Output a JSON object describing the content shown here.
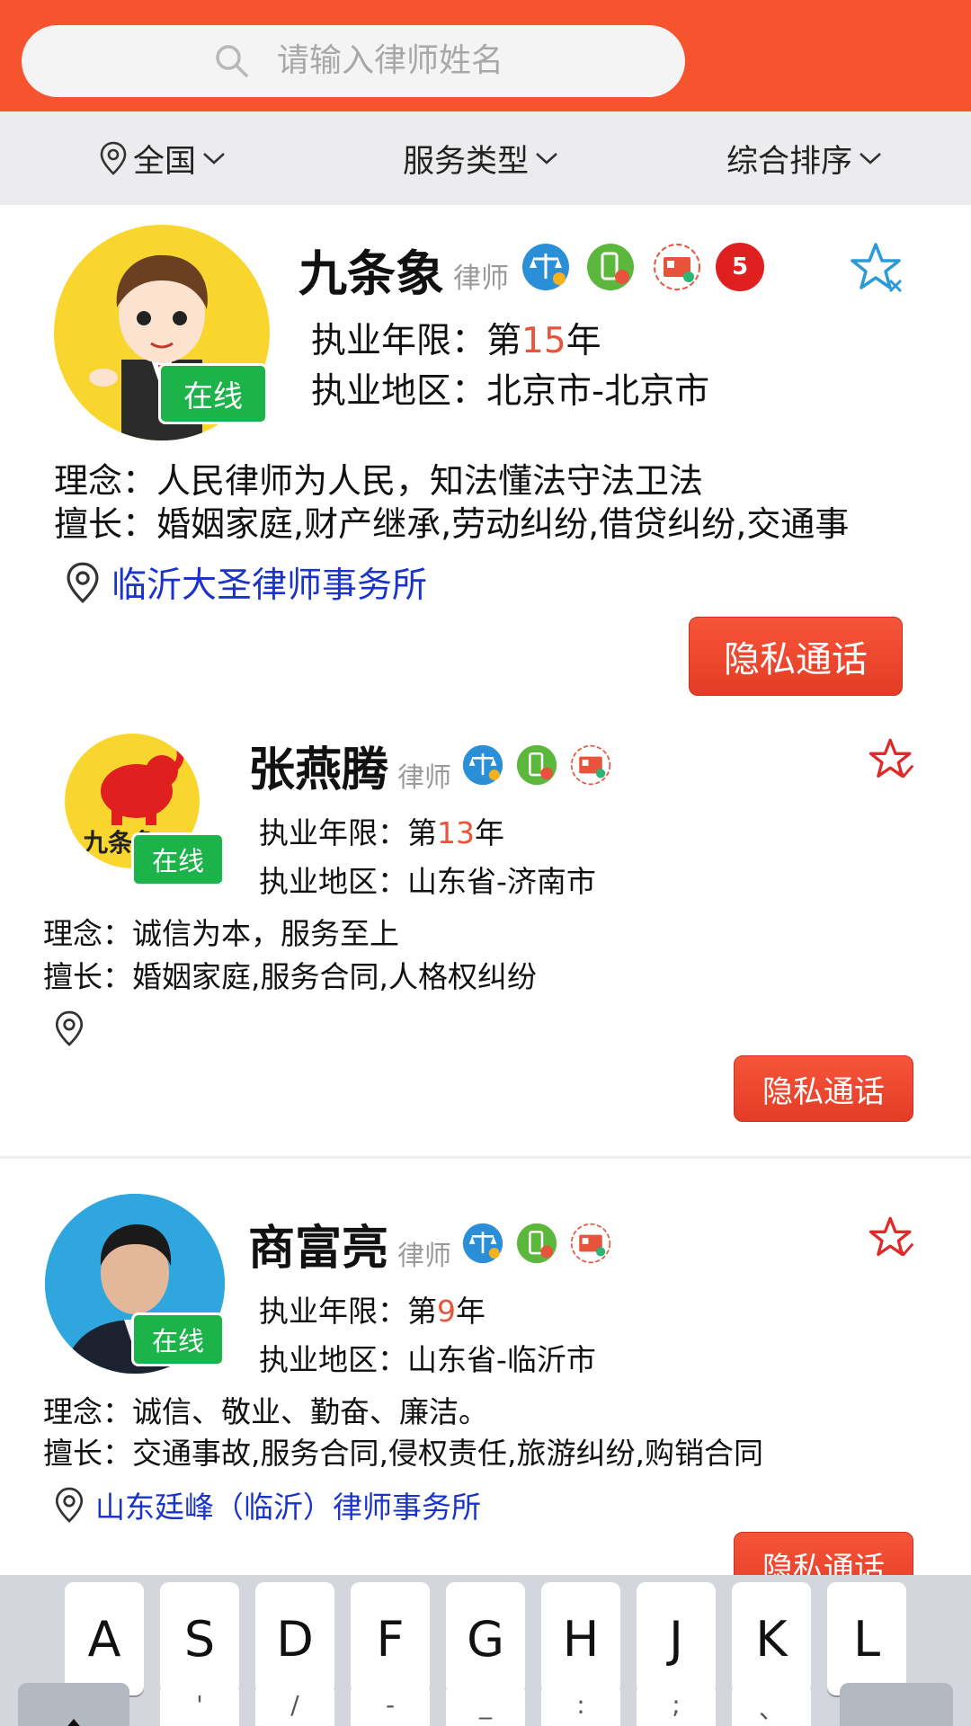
{
  "search": {
    "placeholder": "请输入律师姓名"
  },
  "filters": [
    {
      "label": "全国"
    },
    {
      "label": "服务类型"
    },
    {
      "label": "综合排序"
    }
  ],
  "lawyers": [
    {
      "name": "九条象",
      "role": "律师",
      "online": "在线",
      "years_prefix": "执业年限：第",
      "years": "15",
      "years_suffix": "年",
      "region_label": "执业地区：",
      "region": "北京市-北京市",
      "motto_label": "理念：",
      "motto": "人民律师为人民，知法懂法守法卫法",
      "expertise_label": "擅长：",
      "expertise": "婚姻家庭,财产继承,劳动纠纷,借贷纠纷,交通事",
      "firm": "临沂大圣律师事务所",
      "call": "隐私通话",
      "rank_badge": "5"
    },
    {
      "name": "张燕腾",
      "role": "律师",
      "online": "在线",
      "logo_text": "九条象",
      "years_prefix": "执业年限：第",
      "years": "13",
      "years_suffix": "年",
      "region_label": "执业地区：",
      "region": "山东省-济南市",
      "motto_label": "理念：",
      "motto": "诚信为本，服务至上",
      "expertise_label": "擅长：",
      "expertise": "婚姻家庭,服务合同,人格权纠纷",
      "firm": "",
      "call": "隐私通话"
    },
    {
      "name": "商富亮",
      "role": "律师",
      "online": "在线",
      "years_prefix": "执业年限：第",
      "years": "9",
      "years_suffix": "年",
      "region_label": "执业地区：",
      "region": "山东省-临沂市",
      "motto_label": "理念：",
      "motto": "诚信、敬业、勤奋、廉洁。",
      "expertise_label": "擅长：",
      "expertise": "交通事故,服务合同,侵权责任,旅游纠纷,购销合同",
      "firm": "山东廷峰（临沂）律师事务所",
      "call": "隐私通话"
    }
  ],
  "keyboard": {
    "row2": [
      "A",
      "S",
      "D",
      "F",
      "G",
      "H",
      "J",
      "K",
      "L"
    ],
    "row3": [
      "'",
      "/",
      "-",
      "_",
      ":",
      ";",
      "、"
    ]
  },
  "colors": {
    "brand": "#f6532f",
    "online": "#1bb34a",
    "highlight": "#e8543b",
    "firm_link": "#1a33c8"
  }
}
